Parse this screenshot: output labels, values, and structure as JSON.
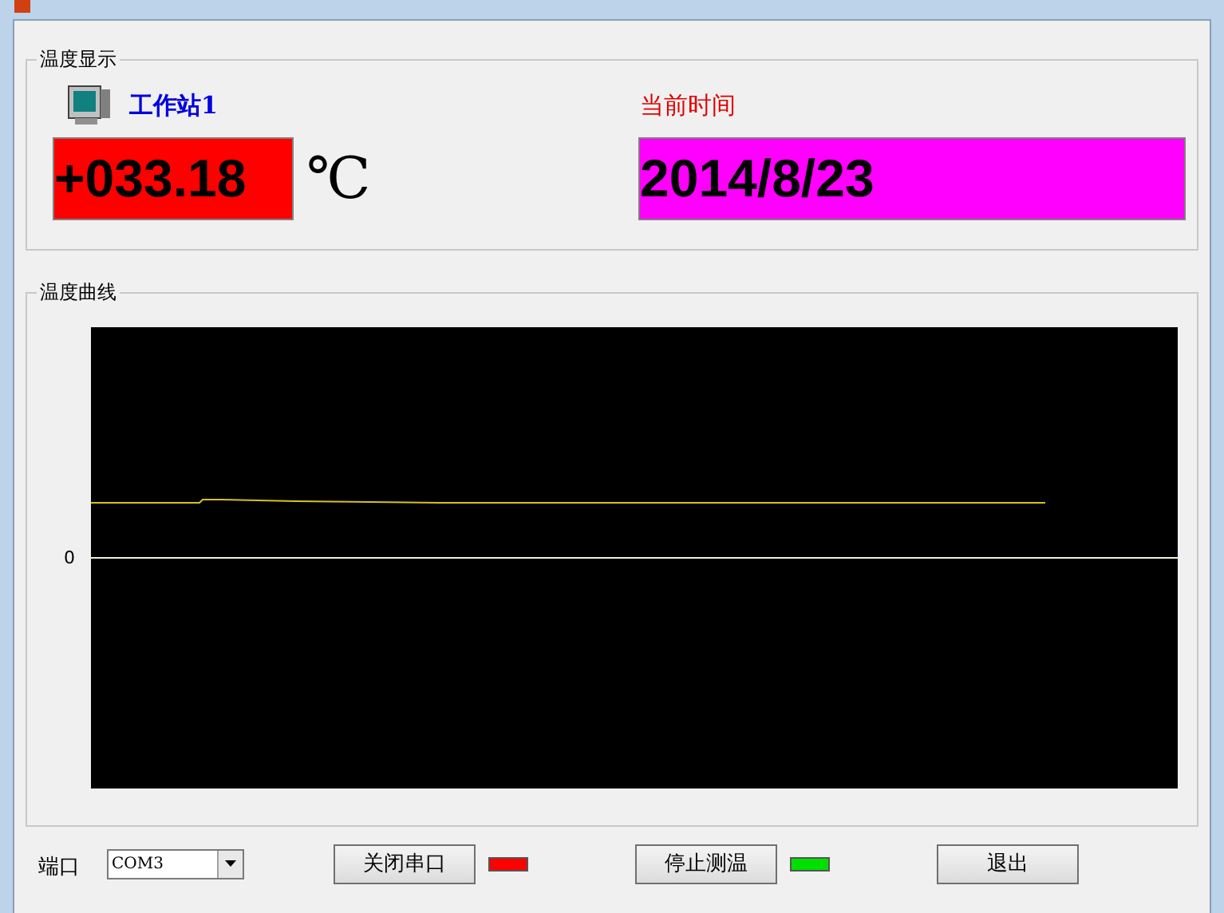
{
  "display_group": {
    "title": "温度显示",
    "station": "工作站1",
    "time_label": "当前时间",
    "temperature": "+033.18",
    "unit": "℃",
    "date": "2014/8/23"
  },
  "curve_group": {
    "title": "温度曲线",
    "y_label": "0"
  },
  "footer": {
    "port_label": "端口",
    "port_value": "COM3",
    "controls": [
      {
        "kind": "button",
        "label": "关闭串口"
      },
      {
        "kind": "lamp",
        "color": "#ff0000"
      },
      {
        "kind": "button",
        "label": "停止测温"
      },
      {
        "kind": "lamp",
        "color": "#00e000"
      },
      {
        "kind": "button",
        "label": "退出"
      }
    ]
  }
}
